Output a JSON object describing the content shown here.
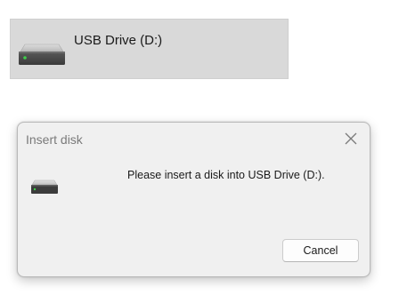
{
  "drive": {
    "label": "USB Drive (D:)",
    "icon": "usb-drive-icon"
  },
  "dialog": {
    "title": "Insert disk",
    "close_icon": "close-icon",
    "icon": "usb-drive-icon",
    "message": "Please insert a disk into USB Drive (D:).",
    "cancel_label": "Cancel"
  },
  "colors": {
    "drive_tile_bg": "#d9d9d9",
    "dialog_bg": "#f0f0f0",
    "drive_led": "#3ecf4a"
  }
}
